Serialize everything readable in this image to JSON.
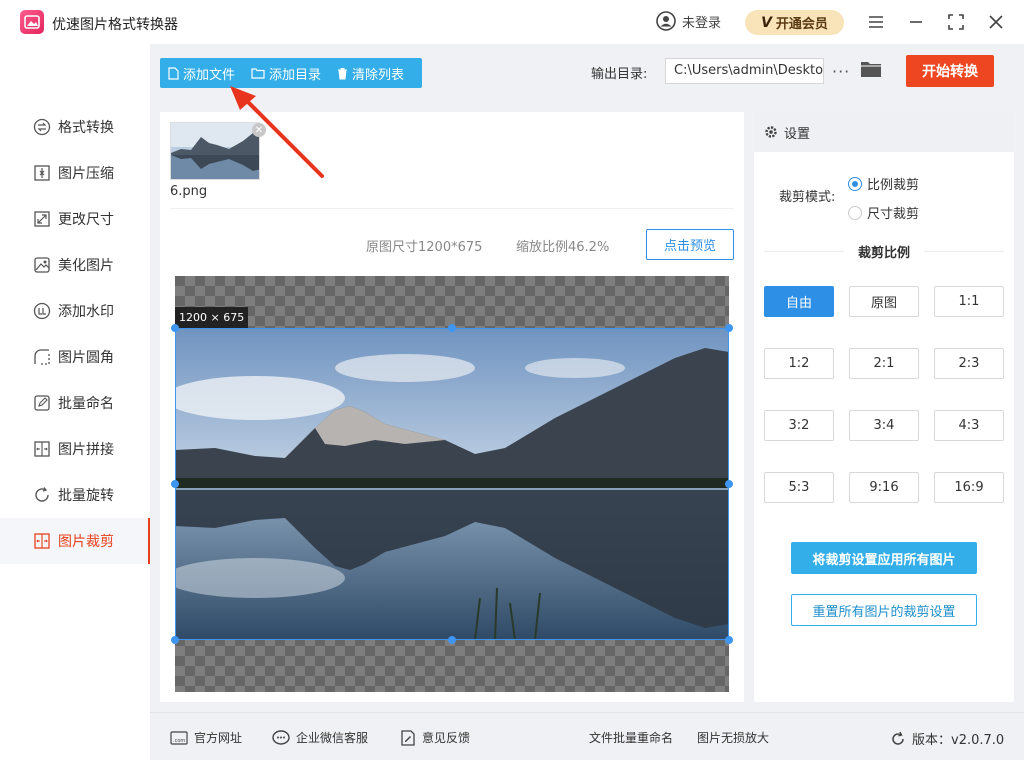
{
  "app": {
    "title": "优速图片格式转换器"
  },
  "header": {
    "user_status": "未登录",
    "vip_label": "开通会员"
  },
  "sidebar": {
    "items": [
      {
        "label": "格式转换",
        "icon": "convert-icon"
      },
      {
        "label": "图片压缩",
        "icon": "compress-icon"
      },
      {
        "label": "更改尺寸",
        "icon": "resize-icon"
      },
      {
        "label": "美化图片",
        "icon": "beautify-icon"
      },
      {
        "label": "添加水印",
        "icon": "watermark-icon"
      },
      {
        "label": "图片圆角",
        "icon": "rounded-corner-icon"
      },
      {
        "label": "批量命名",
        "icon": "rename-icon"
      },
      {
        "label": "图片拼接",
        "icon": "stitch-icon"
      },
      {
        "label": "批量旋转",
        "icon": "rotate-icon"
      },
      {
        "label": "图片裁剪",
        "icon": "crop-icon",
        "active": true
      }
    ]
  },
  "toolbar": {
    "add_file": "添加文件",
    "add_folder": "添加目录",
    "clear_list": "清除列表",
    "output_label": "输出目录:",
    "output_path": "C:\\Users\\admin\\Deskto",
    "more": "···",
    "start": "开始转换"
  },
  "file": {
    "name": "6.png"
  },
  "preview": {
    "original_size": "原图尺寸1200*675",
    "scale": "缩放比例46.2%",
    "preview_btn": "点击预览",
    "dimension_badge": "1200 × 675"
  },
  "settings": {
    "title": "设置",
    "mode_label": "裁剪模式:",
    "mode_options": [
      {
        "label": "比例裁剪",
        "selected": true
      },
      {
        "label": "尺寸裁剪",
        "selected": false
      }
    ],
    "ratio_title": "裁剪比例",
    "ratios": [
      "自由",
      "原图",
      "1:1",
      "1:2",
      "2:1",
      "2:3",
      "3:2",
      "3:4",
      "4:3",
      "5:3",
      "9:16",
      "16:9"
    ],
    "selected_ratio": "自由",
    "apply_all": "将裁剪设置应用所有图片",
    "reset_all": "重置所有图片的裁剪设置"
  },
  "footer": {
    "website": "官方网址",
    "wechat": "企业微信客服",
    "feedback": "意见反馈",
    "batch_rename": "文件批量重命名",
    "upscale": "图片无损放大",
    "version": "版本：v2.0.7.0"
  },
  "colors": {
    "accent": "#33aee8",
    "primary": "#2e8fe6",
    "start": "#ee4620",
    "active_nav": "#e8401c"
  }
}
